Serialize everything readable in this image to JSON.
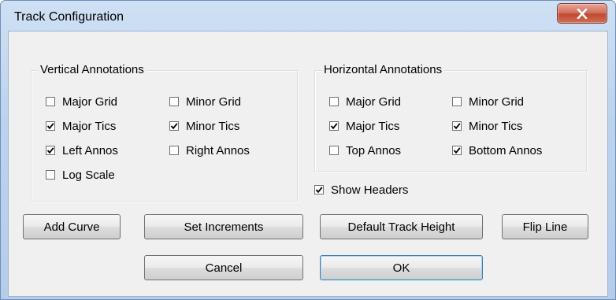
{
  "window": {
    "title": "Track Configuration"
  },
  "vertical_annotations": {
    "label": "Vertical Annotations",
    "options": [
      {
        "label": "Major Grid",
        "checked": false
      },
      {
        "label": "Minor Grid",
        "checked": false
      },
      {
        "label": "Major Tics",
        "checked": true
      },
      {
        "label": "Minor Tics",
        "checked": true
      },
      {
        "label": "Left Annos",
        "checked": true
      },
      {
        "label": "Right Annos",
        "checked": false
      },
      {
        "label": "Log Scale",
        "checked": false
      }
    ]
  },
  "horizontal_annotations": {
    "label": "Horizontal Annotations",
    "options": [
      {
        "label": "Major Grid",
        "checked": false
      },
      {
        "label": "Minor Grid",
        "checked": false
      },
      {
        "label": "Major Tics",
        "checked": true
      },
      {
        "label": "Minor Tics",
        "checked": true
      },
      {
        "label": "Top Annos",
        "checked": false
      },
      {
        "label": "Bottom Annos",
        "checked": true
      }
    ]
  },
  "show_headers": {
    "label": "Show Headers",
    "checked": true
  },
  "buttons": {
    "add_curve": "Add Curve",
    "set_increments": "Set Increments",
    "default_track_height": "Default Track Height",
    "flip_line": "Flip Line",
    "cancel": "Cancel",
    "ok": "OK"
  },
  "icons": {
    "close": "close-icon",
    "check": "checkmark-icon"
  }
}
